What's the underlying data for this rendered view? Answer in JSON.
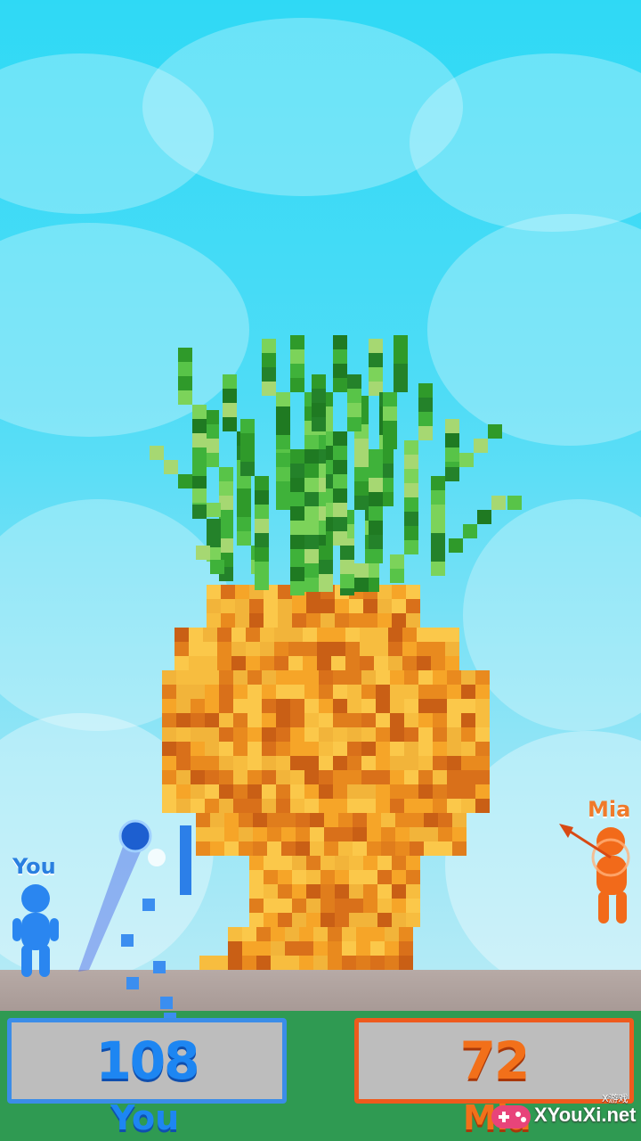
{
  "players": {
    "you": {
      "label": "You",
      "score": "108",
      "name": "You",
      "color": "#1d86f2"
    },
    "opponent": {
      "label": "Mia",
      "score": "72",
      "name": "Mia",
      "color": "#f2701a"
    }
  },
  "target": {
    "object": "pineapple"
  },
  "watermark": {
    "site": "XYouXi.net",
    "tag": "X游戏"
  },
  "colors": {
    "sky": "#2fd9f5",
    "ground": "#a89a96",
    "grass": "#2f9a52"
  }
}
